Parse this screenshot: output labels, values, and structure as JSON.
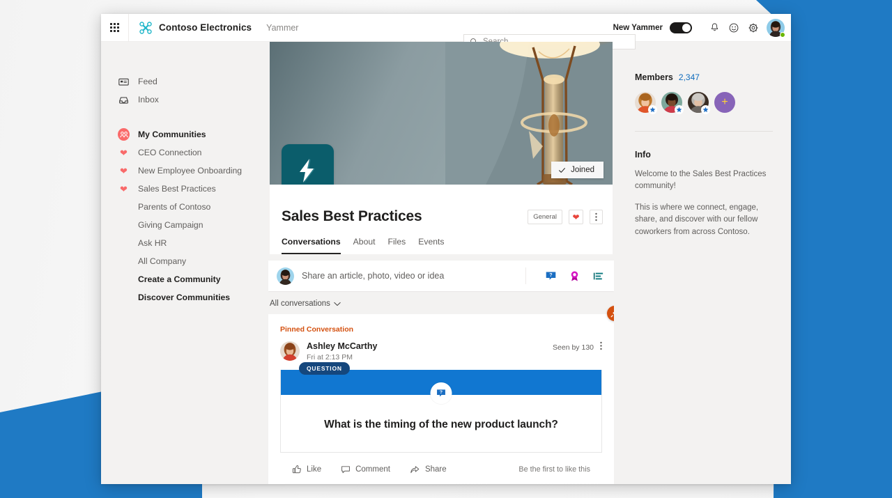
{
  "suitebar": {
    "waffle_label": "App launcher",
    "brand": "Contoso Electronics",
    "app": "Yammer",
    "search_placeholder": "Search",
    "search_value": "",
    "new_yammer_label": "New Yammer",
    "toggle_state": "on",
    "icons": [
      "notifications-bell",
      "feedback-smiley",
      "settings-gear"
    ]
  },
  "sidebar": {
    "items": [
      {
        "label": "Feed",
        "icon": "feed-icon",
        "style": "plain"
      },
      {
        "label": "Inbox",
        "icon": "inbox-icon",
        "style": "plain"
      },
      {
        "label": "My Communities",
        "icon": "communities-icon",
        "style": "selected"
      },
      {
        "label": "CEO Connection",
        "icon": "heart-icon",
        "style": "plain"
      },
      {
        "label": "New Employee Onboarding",
        "icon": "heart-icon",
        "style": "plain"
      },
      {
        "label": "Sales Best Practices",
        "icon": "heart-icon",
        "style": "plain"
      },
      {
        "label": "Parents of Contoso",
        "icon": "none",
        "style": "sub"
      },
      {
        "label": "Giving Campaign",
        "icon": "none",
        "style": "sub"
      },
      {
        "label": "Ask HR",
        "icon": "none",
        "style": "sub"
      },
      {
        "label": "All Company",
        "icon": "none",
        "style": "sub"
      },
      {
        "label": "Create a Community",
        "icon": "none",
        "style": "sub-strong"
      },
      {
        "label": "Discover Communities",
        "icon": "none",
        "style": "sub-strong"
      }
    ]
  },
  "community": {
    "name": "Sales Best Practices",
    "joined_label": "Joined",
    "privacy_pill": "General",
    "logo_icon": "lightning-bolt-icon",
    "cover_alt": "incandescent-light-bulb-photo",
    "tabs": [
      {
        "label": "Conversations",
        "active": true
      },
      {
        "label": "About",
        "active": false
      },
      {
        "label": "Files",
        "active": false
      },
      {
        "label": "Events",
        "active": false
      }
    ]
  },
  "composer": {
    "placeholder": "Share an article, photo, video or idea",
    "value": "",
    "icons": [
      "question-icon",
      "praise-icon",
      "poll-icon"
    ]
  },
  "feed": {
    "filter_label": "All conversations",
    "post": {
      "pinned_label": "Pinned Conversation",
      "author": "Ashley McCarthy",
      "timestamp": "Fri at 2:13 PM",
      "seen_by": "Seen by 130",
      "card_type": "QUESTION",
      "question": "What is the timing of the new product launch?",
      "card_band_color": "#1177d1",
      "tag_color": "#15477d",
      "actions": [
        {
          "label": "Like",
          "icon": "thumbs-up-icon"
        },
        {
          "label": "Comment",
          "icon": "comment-icon"
        },
        {
          "label": "Share",
          "icon": "share-icon"
        }
      ],
      "like_hint": "Be the first to like this"
    }
  },
  "rail": {
    "members_title": "Members",
    "members_count": "2,347",
    "add_member_label": "+",
    "info_title": "Info",
    "info_paragraph_1": "Welcome to the Sales Best Practices community!",
    "info_paragraph_2": "This is where we connect, engage, share, and discover with our fellow coworkers from across Contoso."
  },
  "colors": {
    "accent_blue": "#1177d1",
    "brand_blue": "#1f7ac4",
    "pin_orange": "#d4500f",
    "heart_red": "#f96a6a",
    "group_teal": "#0b5d6b",
    "add_purple": "#8764b8"
  }
}
